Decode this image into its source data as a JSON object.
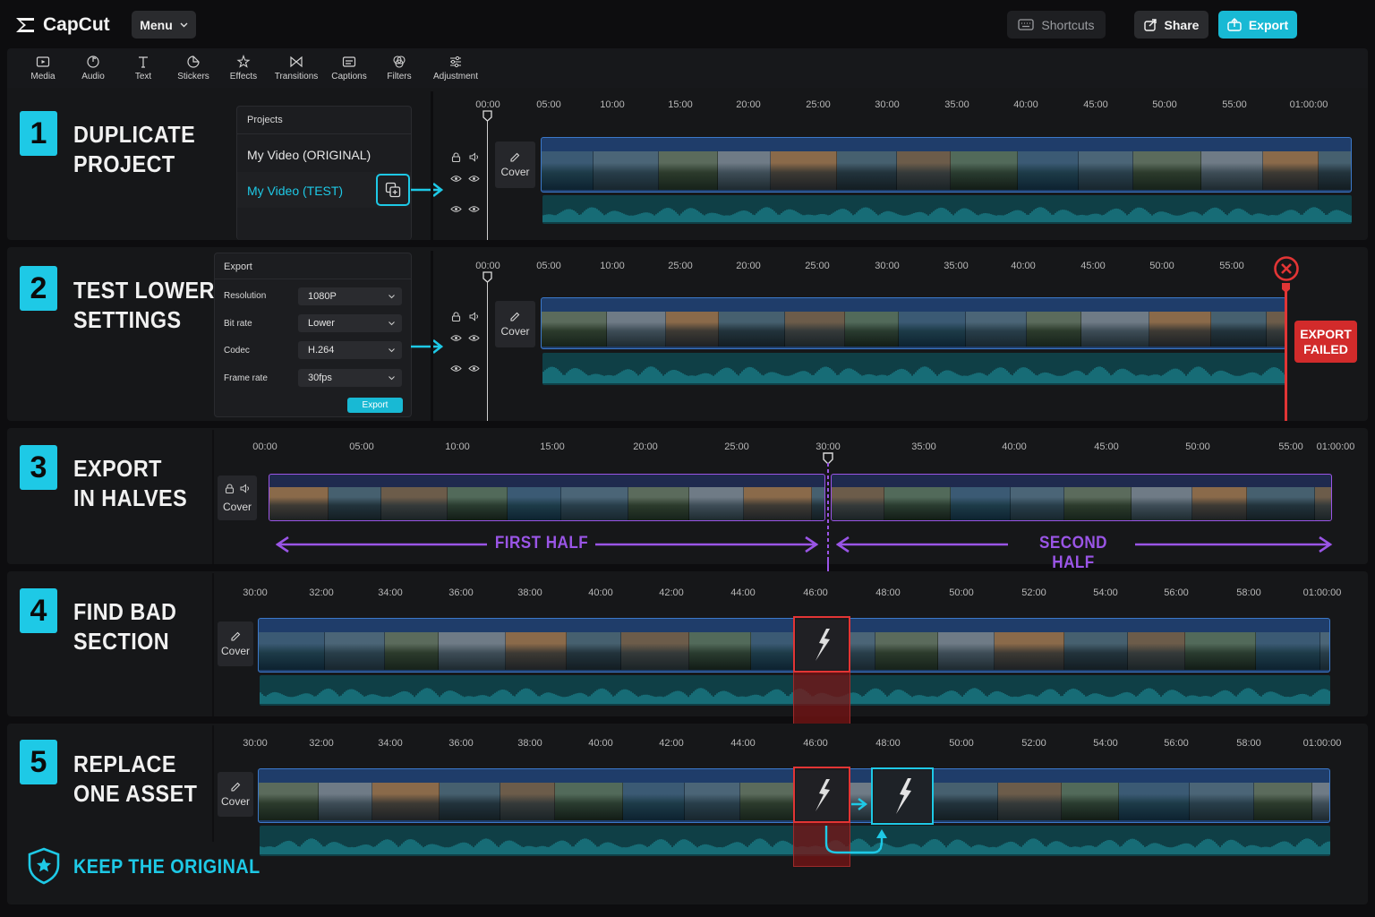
{
  "app": {
    "name": "CapCut"
  },
  "topbar": {
    "menu_label": "Menu",
    "shortcuts_label": "Shortcuts",
    "share_label": "Share",
    "export_label": "Export"
  },
  "toolbar": {
    "items": [
      {
        "label": "Media",
        "icon": "media-icon"
      },
      {
        "label": "Audio",
        "icon": "audio-icon"
      },
      {
        "label": "Text",
        "icon": "text-icon"
      },
      {
        "label": "Stickers",
        "icon": "stickers-icon"
      },
      {
        "label": "Effects",
        "icon": "effects-icon"
      },
      {
        "label": "Transitions",
        "icon": "transitions-icon"
      },
      {
        "label": "Captions",
        "icon": "captions-icon"
      },
      {
        "label": "Filters",
        "icon": "filters-icon"
      },
      {
        "label": "Adjustment",
        "icon": "adjustment-icon"
      }
    ]
  },
  "cover_label": "Cover",
  "steps": [
    {
      "number": "1",
      "title": "DUPLICATE\nPROJECT"
    },
    {
      "number": "2",
      "title": "TEST LOWER\nSETTINGS"
    },
    {
      "number": "3",
      "title": "EXPORT\nIN HALVES"
    },
    {
      "number": "4",
      "title": "FIND BAD\nSECTION"
    },
    {
      "number": "5",
      "title": "REPLACE\nONE ASSET"
    }
  ],
  "projects_panel": {
    "title": "Projects",
    "items": [
      "My Video (ORIGINAL)",
      "My Video (TEST)"
    ]
  },
  "export_panel": {
    "title": "Export",
    "settings": [
      {
        "label": "Resolution",
        "value": "1080P"
      },
      {
        "label": "Bit rate",
        "value": "Lower"
      },
      {
        "label": "Codec",
        "value": "H.264"
      },
      {
        "label": "Frame rate",
        "value": "30fps"
      }
    ],
    "button_label": "Export"
  },
  "export_failed_label": "EXPORT\nFAILED",
  "rulers": {
    "row1": [
      "00:00",
      "05:00",
      "10:00",
      "15:00",
      "20:00",
      "25:00",
      "30:00",
      "35:00",
      "40:00",
      "45:00",
      "50:00",
      "55:00",
      "01:00:00"
    ],
    "row2": [
      "00:00",
      "05:00",
      "10:00",
      "25:00",
      "20:00",
      "25:00",
      "30:00",
      "35:00",
      "40:00",
      "45:00",
      "50:00",
      "55:00"
    ],
    "row3": [
      "00:00",
      "05:00",
      "10:00",
      "15:00",
      "20:00",
      "25:00",
      "30:00",
      "35:00",
      "40:00",
      "45:00",
      "50:00",
      "55:00",
      "01:00:00"
    ],
    "row45": [
      "30:00",
      "32:00",
      "34:00",
      "36:00",
      "38:00",
      "40:00",
      "42:00",
      "44:00",
      "46:00",
      "48:00",
      "50:00",
      "52:00",
      "54:00",
      "56:00",
      "58:00",
      "01:00:00"
    ]
  },
  "halves": {
    "first": "FIRST HALF",
    "second": "SECOND HALF"
  },
  "keep_label": "KEEP THE ORIGINAL",
  "colors": {
    "accent": "#1ec9e6",
    "error": "#d22b2b",
    "purple": "#8f4fe0",
    "track_border": "#3b78c9"
  }
}
